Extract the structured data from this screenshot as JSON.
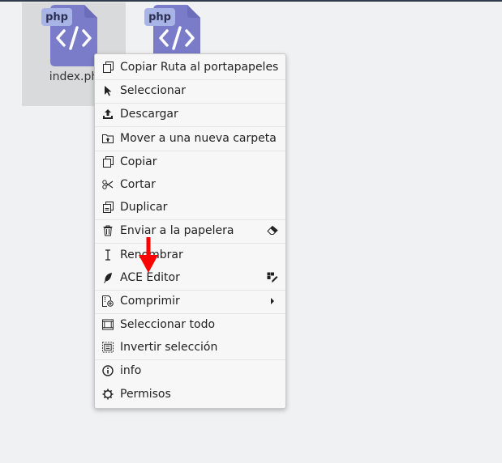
{
  "files": [
    {
      "badge": "php",
      "name": "index.ph",
      "selected": true
    },
    {
      "badge": "php",
      "name": "",
      "selected": false
    }
  ],
  "context_menu": {
    "items": [
      {
        "label": "Copiar Ruta al portapapeles",
        "icon": "copy-path-icon"
      },
      {
        "label": "Seleccionar",
        "icon": "cursor-icon"
      },
      {
        "label": "Descargar",
        "icon": "download-icon"
      },
      {
        "label": "Mover a una nueva carpeta",
        "icon": "move-folder-icon"
      },
      {
        "label": "Copiar",
        "icon": "copy-icon"
      },
      {
        "label": "Cortar",
        "icon": "scissors-icon"
      },
      {
        "label": "Duplicar",
        "icon": "duplicate-icon"
      },
      {
        "label": "Enviar a la papelera",
        "icon": "trash-icon",
        "right_icon": "eraser-icon"
      },
      {
        "label": "Renombrar",
        "icon": "text-cursor-icon"
      },
      {
        "label": "ACE Editor",
        "icon": "feather-icon",
        "right_icon": "grid-edit-icon"
      },
      {
        "label": "Comprimir",
        "icon": "compress-icon",
        "right_icon": "submenu-arrow-icon"
      },
      {
        "label": "Seleccionar todo",
        "icon": "select-all-icon"
      },
      {
        "label": "Invertir selección",
        "icon": "invert-selection-icon"
      },
      {
        "label": "info",
        "icon": "info-icon"
      },
      {
        "label": "Permisos",
        "icon": "gear-icon"
      }
    ]
  },
  "colors": {
    "file_icon": "#7a7cc9",
    "file_badge": "#a9b4e6",
    "highlight_arrow": "#ff0000"
  }
}
